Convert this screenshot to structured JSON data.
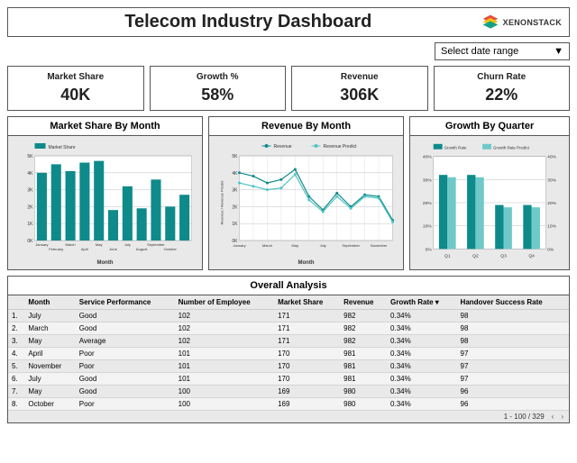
{
  "title": "Telecom Industry Dashboard",
  "brand": "XENONSTACK",
  "date_select": "Select date range",
  "kpis": [
    {
      "label": "Market Share",
      "value": "40K"
    },
    {
      "label": "Growth %",
      "value": "58%"
    },
    {
      "label": "Revenue",
      "value": "306K"
    },
    {
      "label": "Churn Rate",
      "value": "22%"
    }
  ],
  "charts": {
    "market": {
      "title": "Market Share By Month",
      "legend": "Market Share",
      "xlabel": "Month"
    },
    "revenue": {
      "title": "Revenue By Month",
      "legend1": "Revenue",
      "legend2": "Revenue Predict",
      "xlabel": "Month",
      "ylabel": "Revenue / Revenue Predict"
    },
    "growth": {
      "title": "Growth By Quarter",
      "legend1": "Growth Rate",
      "legend2": "Growth Rate Predict"
    }
  },
  "chart_data": [
    {
      "type": "bar",
      "title": "Market Share By Month",
      "categories": [
        "January",
        "February",
        "March",
        "April",
        "May",
        "June",
        "July",
        "August",
        "September",
        "October"
      ],
      "values": [
        4000,
        4500,
        4100,
        4600,
        4700,
        1800,
        3200,
        1900,
        3600,
        2000,
        2700
      ],
      "ylim": [
        0,
        5000
      ],
      "xlabel": "Month",
      "ylabel": ""
    },
    {
      "type": "line",
      "title": "Revenue By Month",
      "x": [
        "January",
        "February",
        "March",
        "April",
        "May",
        "June",
        "July",
        "August",
        "September",
        "October",
        "November"
      ],
      "series": [
        {
          "name": "Revenue",
          "values": [
            4000,
            3800,
            3400,
            3600,
            4200,
            2600,
            1800,
            2800,
            2000,
            2700,
            2600,
            1200
          ]
        },
        {
          "name": "Revenue Predict",
          "values": [
            3400,
            3200,
            3000,
            3100,
            3900,
            2400,
            1700,
            2600,
            1900,
            2600,
            2500,
            1100
          ]
        }
      ],
      "ylim": [
        0,
        5000
      ],
      "xlabel": "Month",
      "ylabel": "Revenue / Revenue Predict"
    },
    {
      "type": "bar",
      "title": "Growth By Quarter",
      "categories": [
        "Q1",
        "Q2",
        "Q3",
        "Q4"
      ],
      "series": [
        {
          "name": "Growth Rate",
          "values": [
            32,
            32,
            19,
            19
          ]
        },
        {
          "name": "Growth Rate Predict",
          "values": [
            31,
            31,
            18,
            18
          ]
        }
      ],
      "ylim": [
        0,
        40
      ],
      "xlabel": "",
      "ylabel": "%"
    }
  ],
  "analysis": {
    "title": "Overall Analysis",
    "headers": [
      "",
      "Month",
      "Service Performance",
      "Number of Employee",
      "Market Share",
      "Revenue",
      "Growth Rate ▾",
      "Handover Success Rate"
    ],
    "rows": [
      [
        "1.",
        "July",
        "Good",
        "102",
        "171",
        "982",
        "0.34%",
        "98"
      ],
      [
        "2.",
        "March",
        "Good",
        "102",
        "171",
        "982",
        "0.34%",
        "98"
      ],
      [
        "3.",
        "May",
        "Average",
        "102",
        "171",
        "982",
        "0.34%",
        "98"
      ],
      [
        "4.",
        "April",
        "Poor",
        "101",
        "170",
        "981",
        "0.34%",
        "97"
      ],
      [
        "5.",
        "November",
        "Poor",
        "101",
        "170",
        "981",
        "0.34%",
        "97"
      ],
      [
        "6.",
        "July",
        "Good",
        "101",
        "170",
        "981",
        "0.34%",
        "97"
      ],
      [
        "7.",
        "May",
        "Good",
        "100",
        "169",
        "980",
        "0.34%",
        "96"
      ],
      [
        "8.",
        "October",
        "Poor",
        "100",
        "169",
        "980",
        "0.34%",
        "96"
      ]
    ],
    "pager": "1 - 100 / 329"
  }
}
